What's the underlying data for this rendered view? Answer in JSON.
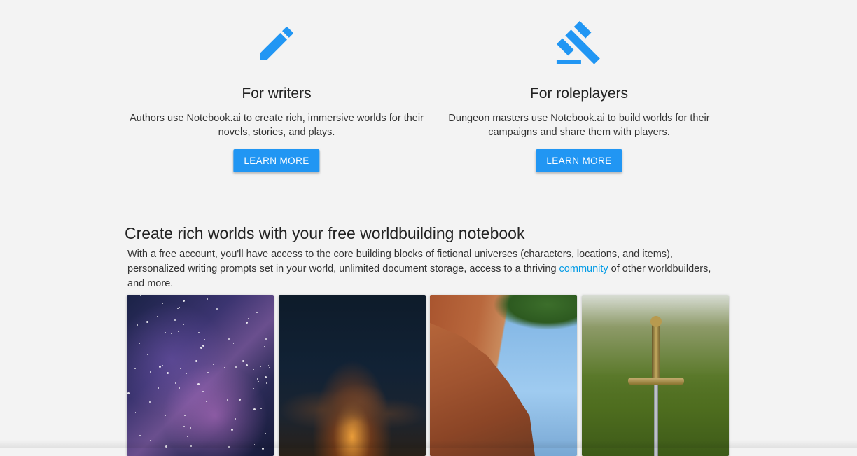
{
  "audiences": [
    {
      "icon": "pencil-icon",
      "title": "For writers",
      "description": "Authors use Notebook.ai to create rich, immersive worlds for their novels, stories, and plays.",
      "button_label": "LEARN MORE"
    },
    {
      "icon": "gavel-icon",
      "title": "For roleplayers",
      "description": "Dungeon masters use Notebook.ai to build worlds for their campaigns and share them with players.",
      "button_label": "LEARN MORE"
    }
  ],
  "promo": {
    "heading": "Create rich worlds with your free worldbuilding notebook",
    "text_before": "With a free account, you'll have access to the core building blocks of fictional universes (characters, locations, and items), personalized writing prompts set in your world, unlimited document storage, access to a thriving ",
    "link_label": "community",
    "text_after": " of other worldbuilders, and more."
  },
  "gallery": [
    {
      "subject": "starry-galaxy-image"
    },
    {
      "subject": "campfire-image"
    },
    {
      "subject": "canyon-cliff-image"
    },
    {
      "subject": "sword-in-grass-image"
    }
  ],
  "colors": {
    "accent": "#2196f3",
    "link": "#039be5",
    "background": "#f3f3f3"
  }
}
